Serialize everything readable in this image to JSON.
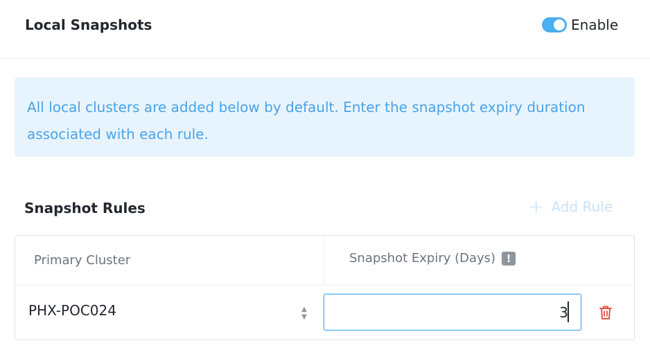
{
  "header": {
    "title": "Local Snapshots",
    "toggle": {
      "label": "Enable",
      "state": "on",
      "color": "#4aaef0"
    }
  },
  "info": {
    "text": "All local clusters are added below by default. Enter the snapshot expiry duration associated with each rule.",
    "background": "#e8f4fd",
    "text_color": "#4aa3e8"
  },
  "rules": {
    "title": "Snapshot Rules",
    "add_rule_label": "Add Rule",
    "add_rule_icon": "plus-icon",
    "columns": [
      "Primary Cluster",
      "Snapshot Expiry (Days)"
    ],
    "column_info_icon": "exclamation-icon",
    "rows": [
      {
        "cluster": "PHX-POC024",
        "expiry_days": "3",
        "sort_icon": "sort-arrows-icon",
        "delete_icon": "trash-icon"
      }
    ],
    "delete_color": "#e5534b"
  }
}
